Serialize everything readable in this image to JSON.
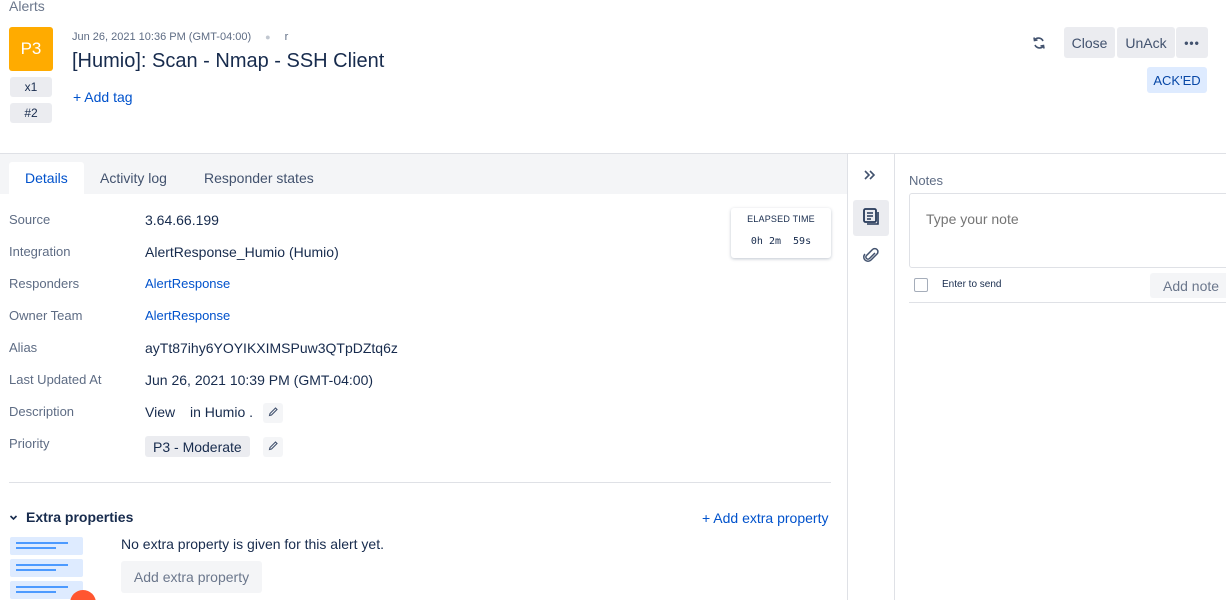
{
  "breadcrumb": "Alerts",
  "alert": {
    "priority": "P3",
    "count": "x1",
    "number": "#2",
    "created": "Jun 26, 2021 10:36 PM (GMT-04:00)",
    "creator": "r",
    "title": "[Humio]: Scan - Nmap - SSH Client",
    "add_tag": "+ Add tag",
    "status": "ACK'ED"
  },
  "actions": {
    "close": "Close",
    "unack": "UnAck",
    "more": "•••"
  },
  "tabs": [
    "Details",
    "Activity log",
    "Responder states"
  ],
  "details": {
    "source_label": "Source",
    "source": "3.64.66.199",
    "integration_label": "Integration",
    "integration": "AlertResponse_Humio (Humio)",
    "responders_label": "Responders",
    "responders": "AlertResponse",
    "owner_label": "Owner Team",
    "owner": "AlertResponse",
    "alias_label": "Alias",
    "alias": "ayTt87ihy6YOYIKXIMSPuw3QTpDZtq6z",
    "updated_label": "Last Updated At",
    "updated": "Jun 26, 2021 10:39 PM (GMT-04:00)",
    "description_label": "Description",
    "description_view": "View",
    "description_rest": "in Humio .",
    "priority_label": "Priority",
    "priority": "P3 - Moderate"
  },
  "elapsed": {
    "label": "ELAPSED TIME",
    "value": "0h 2m  59s"
  },
  "extra": {
    "heading": "Extra properties",
    "add_link": "+ Add extra property",
    "empty": "No extra property is given for this alert yet.",
    "add_button": "Add extra property"
  },
  "notes": {
    "label": "Notes",
    "placeholder": "Type your note",
    "enter_to_send": "Enter to send",
    "add_note": "Add note"
  },
  "colors": {
    "priority": "#ffab00",
    "link": "#0052cc",
    "ack_bg": "#deebff"
  }
}
